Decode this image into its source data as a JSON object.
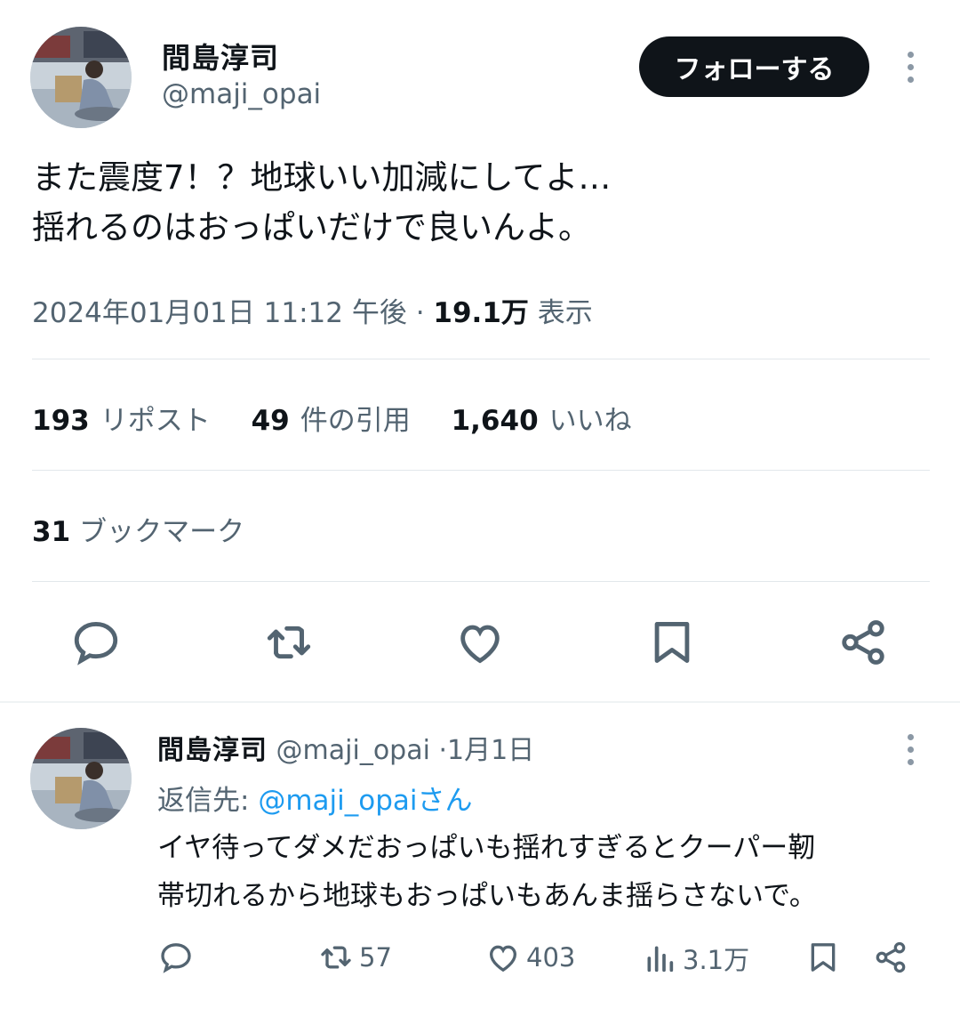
{
  "tweet": {
    "author_name": "間島淳司",
    "author_handle": "@maji_opai",
    "follow_label": "フォローする",
    "text_line1": "また震度7！？地球いい加減にしてよ…",
    "text_line2": "揺れるのはおっぱいだけで良いんよ。",
    "timestamp": "2024年01月01日 11:12 午後",
    "separator": " · ",
    "views": "19.1万",
    "views_label": "表示",
    "reposts_count": "193",
    "reposts_label": "リポスト",
    "quotes_count": "49",
    "quotes_label": "件の引用",
    "likes_count": "1,640",
    "likes_label": "いいね",
    "bookmarks_count": "31",
    "bookmarks_label": "ブックマーク"
  },
  "actions": {
    "icons": [
      "reply-icon",
      "repost-icon",
      "like-icon",
      "bookmark-icon",
      "share-icon"
    ]
  },
  "reply": {
    "author_name": "間島淳司",
    "author_handle": "@maji_opai",
    "dot": "·",
    "date": "1月1日",
    "reply_to_prefix": "返信先: ",
    "reply_to_mention": "@maji_opaiさん",
    "text_line1": "イヤ待ってダメだおっぱいも揺れすぎるとクーパー靭",
    "text_line2": "帯切れるから地球もおっぱいもあんま揺らさないで。",
    "reposts": "57",
    "likes": "403",
    "views": "3.1万"
  },
  "colors": {
    "text": "#0f1419",
    "secondary": "#536471",
    "link": "#1d9bf0",
    "divider": "#e2e7eb"
  }
}
